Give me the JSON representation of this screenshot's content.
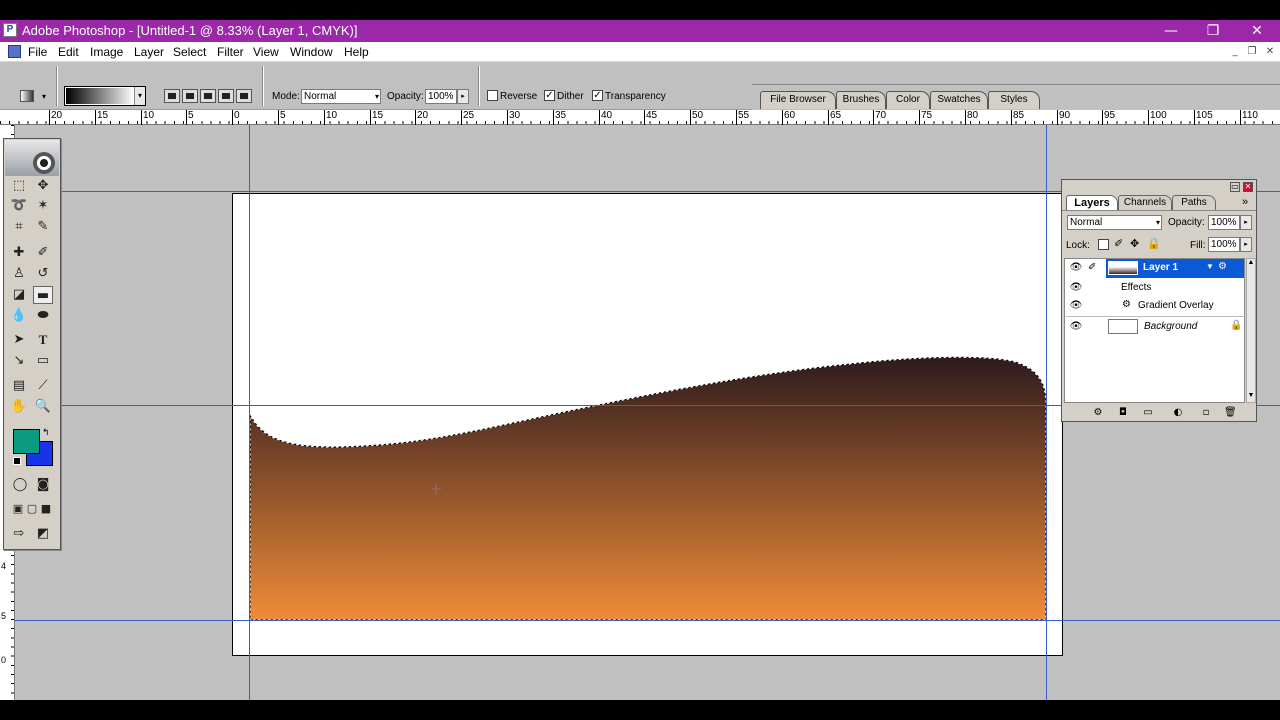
{
  "window": {
    "title": "Adobe Photoshop - [Untitled-1 @ 8.33% (Layer 1, CMYK)]",
    "app_icon": "photoshop-icon",
    "minimize_glyph": "—",
    "maximize_glyph": "❐",
    "close_glyph": "✕"
  },
  "menu": {
    "items": [
      "File",
      "Edit",
      "Image",
      "Layer",
      "Select",
      "Filter",
      "View",
      "Window",
      "Help"
    ],
    "mdi_minimize": "_",
    "mdi_restore": "❐",
    "mdi_close": "✕"
  },
  "options": {
    "mode_label": "Mode:",
    "mode_value": "Normal",
    "opacity_label": "Opacity:",
    "opacity_value": "100%",
    "reverse_label": "Reverse",
    "reverse_checked": false,
    "dither_label": "Dither",
    "dither_checked": true,
    "transparency_label": "Transparency",
    "transparency_checked": true,
    "check_glyph": "✓",
    "dropdown_glyph": "▾",
    "spin_glyph": "▸"
  },
  "palette_well": {
    "tabs": [
      "File Browser",
      "Brushes",
      "Color",
      "Swatches",
      "Styles"
    ]
  },
  "rulers": {
    "horizontal": [
      "20",
      "15",
      "10",
      "5",
      "0",
      "5",
      "10",
      "15",
      "20",
      "25",
      "30",
      "35",
      "40",
      "45",
      "50",
      "55",
      "60",
      "65",
      "70",
      "75",
      "80",
      "85",
      "90",
      "95",
      "100",
      "105",
      "110"
    ],
    "vertical": [
      "4",
      "5",
      "0"
    ]
  },
  "toolbox": {
    "foreground_color": "#0b9a82",
    "background_color": "#1833e8",
    "tools": [
      "marquee-icon",
      "move-icon",
      "lasso-icon",
      "magic-wand-icon",
      "crop-icon",
      "slice-icon",
      "healing-brush-icon",
      "brush-icon",
      "clone-stamp-icon",
      "history-brush-icon",
      "eraser-icon",
      "gradient-icon",
      "blur-icon",
      "dodge-icon",
      "path-selection-icon",
      "type-icon",
      "pen-icon",
      "rectangle-icon",
      "notes-icon",
      "eyedropper-icon",
      "hand-icon",
      "zoom-icon"
    ]
  },
  "canvas": {
    "gradient_top": "#2e1a1e",
    "gradient_bottom": "#f08c38"
  },
  "layers_panel": {
    "tabs": [
      "Layers",
      "Channels",
      "Paths"
    ],
    "blend_mode": "Normal",
    "opacity_label": "Opacity:",
    "opacity_value": "100%",
    "lock_label": "Lock:",
    "fill_label": "Fill:",
    "fill_value": "100%",
    "layers": [
      {
        "name": "Layer 1",
        "selected": true
      },
      {
        "name": "Effects",
        "selected": false
      },
      {
        "name": "Gradient Overlay",
        "selected": false
      },
      {
        "name": "Background",
        "selected": false
      }
    ],
    "menu_glyph": "»"
  }
}
